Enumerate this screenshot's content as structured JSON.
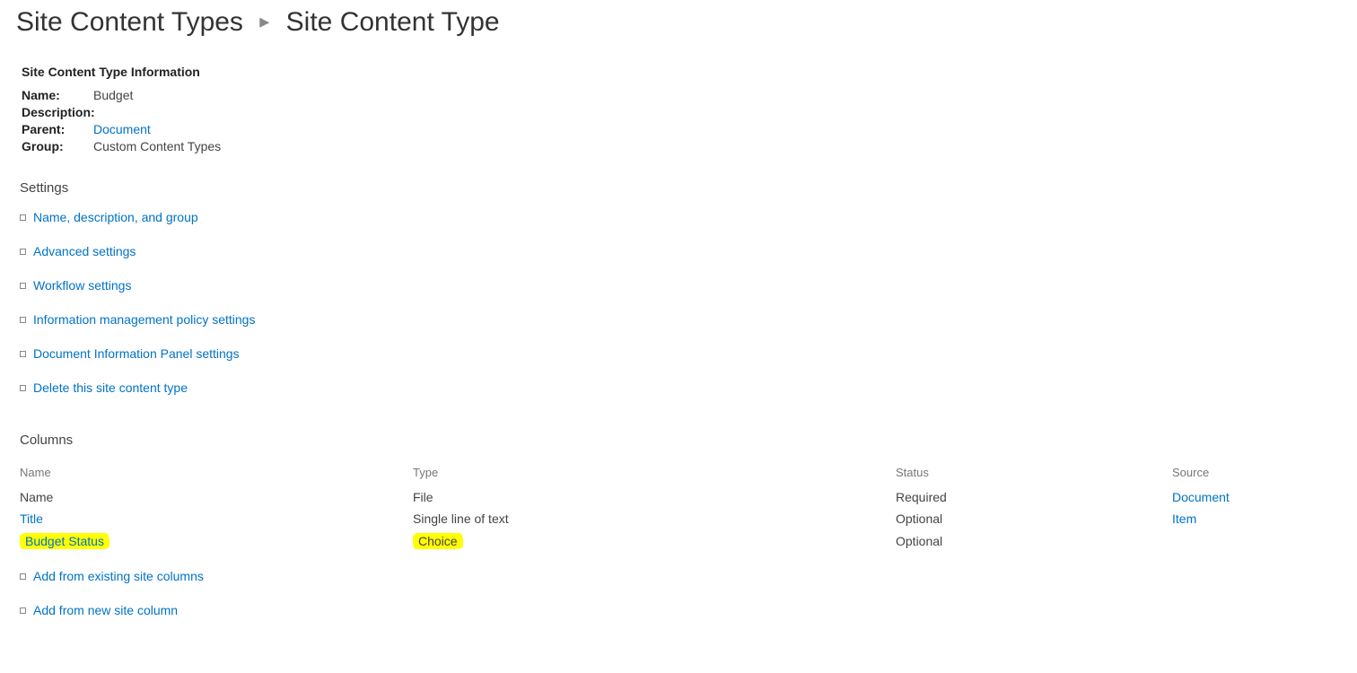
{
  "breadcrumb": {
    "root": "Site Content Types",
    "current": "Site Content Type"
  },
  "info": {
    "heading": "Site Content Type Information",
    "name_label": "Name:",
    "name_value": "Budget",
    "desc_label": "Description:",
    "desc_value": "",
    "parent_label": "Parent:",
    "parent_value": "Document",
    "group_label": "Group:",
    "group_value": "Custom Content Types"
  },
  "settings": {
    "heading": "Settings",
    "links": [
      "Name, description, and group",
      "Advanced settings",
      "Workflow settings",
      "Information management policy settings",
      "Document Information Panel settings",
      "Delete this site content type"
    ]
  },
  "columns": {
    "heading": "Columns",
    "headers": {
      "name": "Name",
      "type": "Type",
      "status": "Status",
      "source": "Source"
    },
    "rows": [
      {
        "name": "Name",
        "type": "File",
        "status": "Required",
        "source": "Document",
        "name_link": false,
        "source_link": true,
        "hl": false
      },
      {
        "name": "Title",
        "type": "Single line of text",
        "status": "Optional",
        "source": "Item",
        "name_link": true,
        "source_link": true,
        "hl": false
      },
      {
        "name": "Budget Status",
        "type": "Choice",
        "status": "Optional",
        "source": "",
        "name_link": true,
        "source_link": false,
        "hl": true
      }
    ],
    "actions": [
      "Add from existing site columns",
      "Add from new site column"
    ]
  }
}
